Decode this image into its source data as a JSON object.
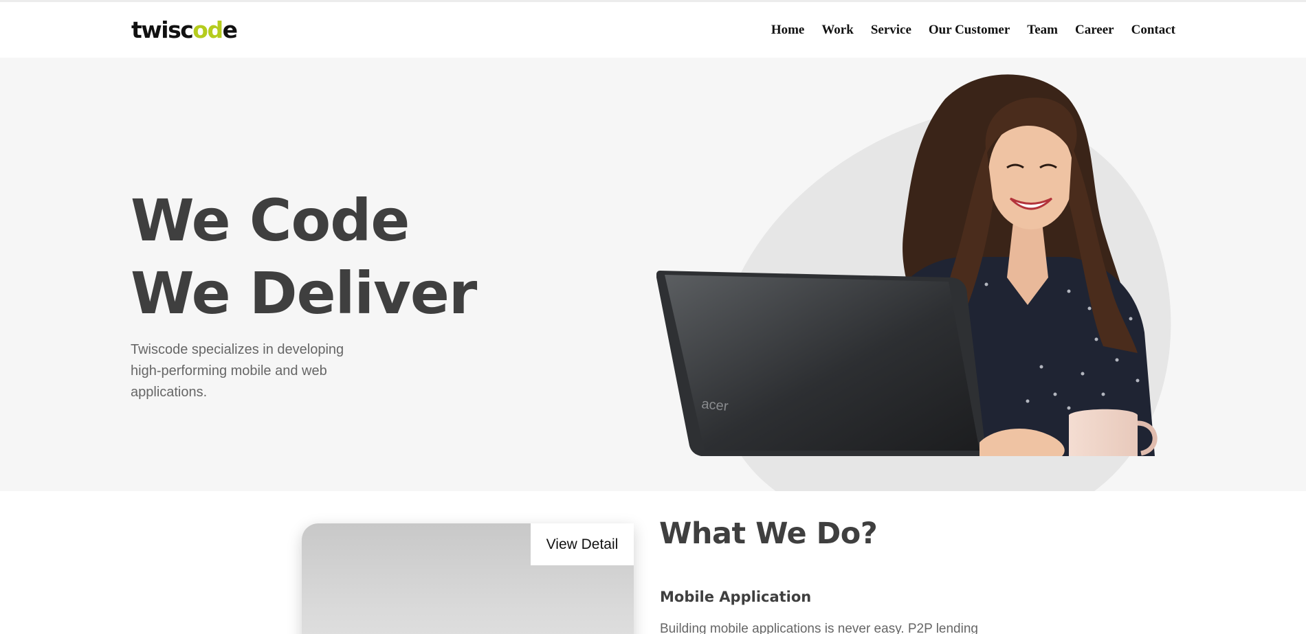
{
  "brand": {
    "logo_text_main": "twisc",
    "logo_text_accent": "od",
    "logo_text_end": "e",
    "accent_color": "#b5cc1e"
  },
  "nav": {
    "items": [
      "Home",
      "Work",
      "Service",
      "Our Customer",
      "Team",
      "Career",
      "Contact"
    ]
  },
  "hero": {
    "title_line1": "We Code",
    "title_line2": "We Deliver",
    "description": "Twiscode specializes in developing high-performing mobile and web applications.",
    "image_icon": "woman-with-laptop-photo"
  },
  "what_we_do": {
    "card_button": "View Detail",
    "title": "What We Do?",
    "service_title": "Mobile Application",
    "service_description": "Building mobile applications is never easy. P2P lending"
  }
}
